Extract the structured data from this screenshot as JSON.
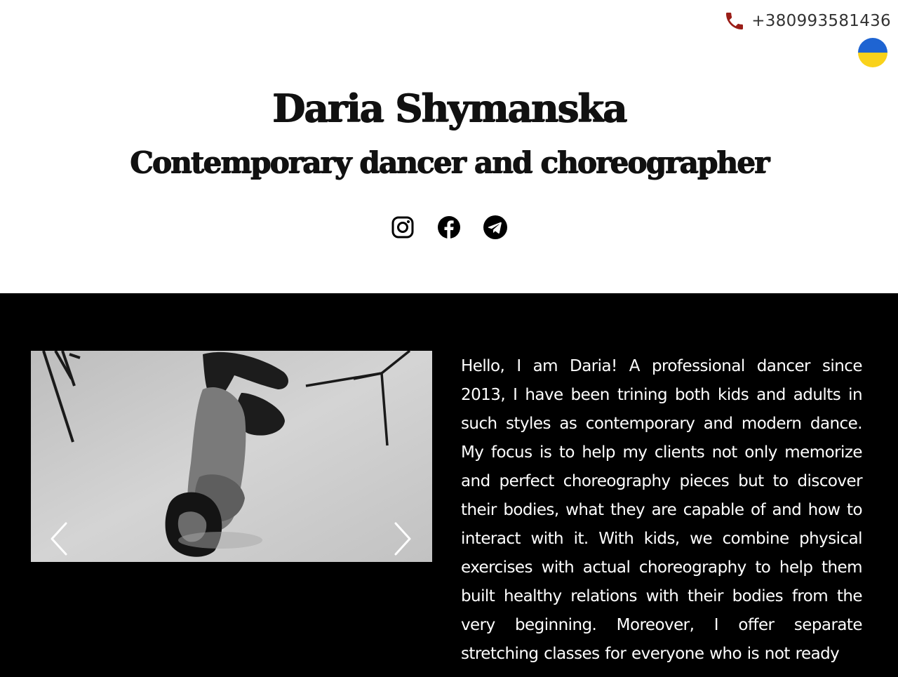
{
  "contact": {
    "phone": "+380993581436",
    "phone_icon": "phone-icon",
    "language_flag": "ukraine-flag-icon",
    "flag_colors": [
      "#1e64d2",
      "#f9d21b"
    ]
  },
  "header": {
    "title": "Daria Shymanska",
    "subtitle": "Contemporary dancer and choreographer"
  },
  "socials": [
    {
      "name": "instagram",
      "icon": "instagram-icon"
    },
    {
      "name": "facebook",
      "icon": "facebook-icon"
    },
    {
      "name": "telegram",
      "icon": "telegram-icon"
    }
  ],
  "about": {
    "carousel": {
      "prev_icon": "chevron-left-icon",
      "next_icon": "chevron-right-icon"
    },
    "text": "Hello, I am Daria! A professional dancer since 2013, I have been trining both kids and adults in such styles as contemporary and modern dance. My focus is to help my clients not only memorize and perfect choreography pieces but to discover their bodies, what they are capable of and how to interact with it. With kids, we combine physical exercises with actual choreography to help them built healthy relations with their bodies from the very beginning. Moreover, I offer separate stretching classes for everyone who is not ready"
  },
  "colors": {
    "about_background": "#000000",
    "header_background": "#ffffff",
    "text_dark": "#111111",
    "phone_icon": "#9a1d17"
  }
}
